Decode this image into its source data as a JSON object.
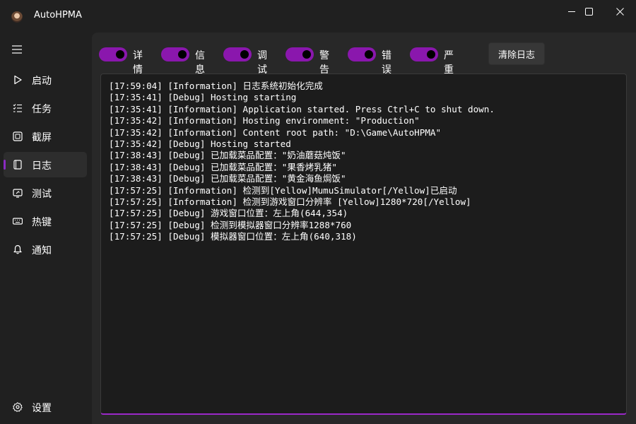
{
  "window": {
    "title": "AutoHPMA"
  },
  "sidebar": {
    "items": [
      {
        "label": "启动",
        "icon": "play-icon"
      },
      {
        "label": "任务",
        "icon": "task-list-icon"
      },
      {
        "label": "截屏",
        "icon": "screenshot-icon"
      },
      {
        "label": "日志",
        "icon": "log-icon"
      },
      {
        "label": "测试",
        "icon": "test-icon"
      },
      {
        "label": "热键",
        "icon": "keyboard-icon"
      },
      {
        "label": "通知",
        "icon": "bell-icon"
      }
    ],
    "settings_label": "设置",
    "active_index": 3
  },
  "filters": [
    {
      "label": "详情",
      "on": true
    },
    {
      "label": "信息",
      "on": true
    },
    {
      "label": "调试",
      "on": true
    },
    {
      "label": "警告",
      "on": true
    },
    {
      "label": "错误",
      "on": true
    },
    {
      "label": "严重",
      "on": true
    }
  ],
  "clear_button_label": "清除日志",
  "colors": {
    "accent": "#8a17ad",
    "background": "#202020",
    "content": "#282828",
    "log_background": "#1c1c1c"
  },
  "log_lines": [
    "[17:59:04] [Information] 日志系统初始化完成",
    "[17:35:41] [Debug] Hosting starting",
    "[17:35:41] [Information] Application started. Press Ctrl+C to shut down.",
    "[17:35:42] [Information] Hosting environment: \"Production\"",
    "[17:35:42] [Information] Content root path: \"D:\\Game\\AutoHPMA\"",
    "[17:35:42] [Debug] Hosting started",
    "[17:38:43] [Debug] 已加载菜品配置：\"奶油蘑菇炖饭\"",
    "[17:38:43] [Debug] 已加载菜品配置：\"果香烤乳猪\"",
    "[17:38:43] [Debug] 已加载菜品配置：\"黄金海鱼焗饭\"",
    "[17:57:25] [Information] 检测到[Yellow]MumuSimulator[/Yellow]已启动",
    "[17:57:25] [Information] 检测到游戏窗口分辨率 [Yellow]1280*720[/Yellow]",
    "[17:57:25] [Debug] 游戏窗口位置：左上角(644,354)",
    "[17:57:25] [Debug] 检测到模拟器窗口分辨率1288*760",
    "[17:57:25] [Debug] 模拟器窗口位置：左上角(640,318)"
  ]
}
